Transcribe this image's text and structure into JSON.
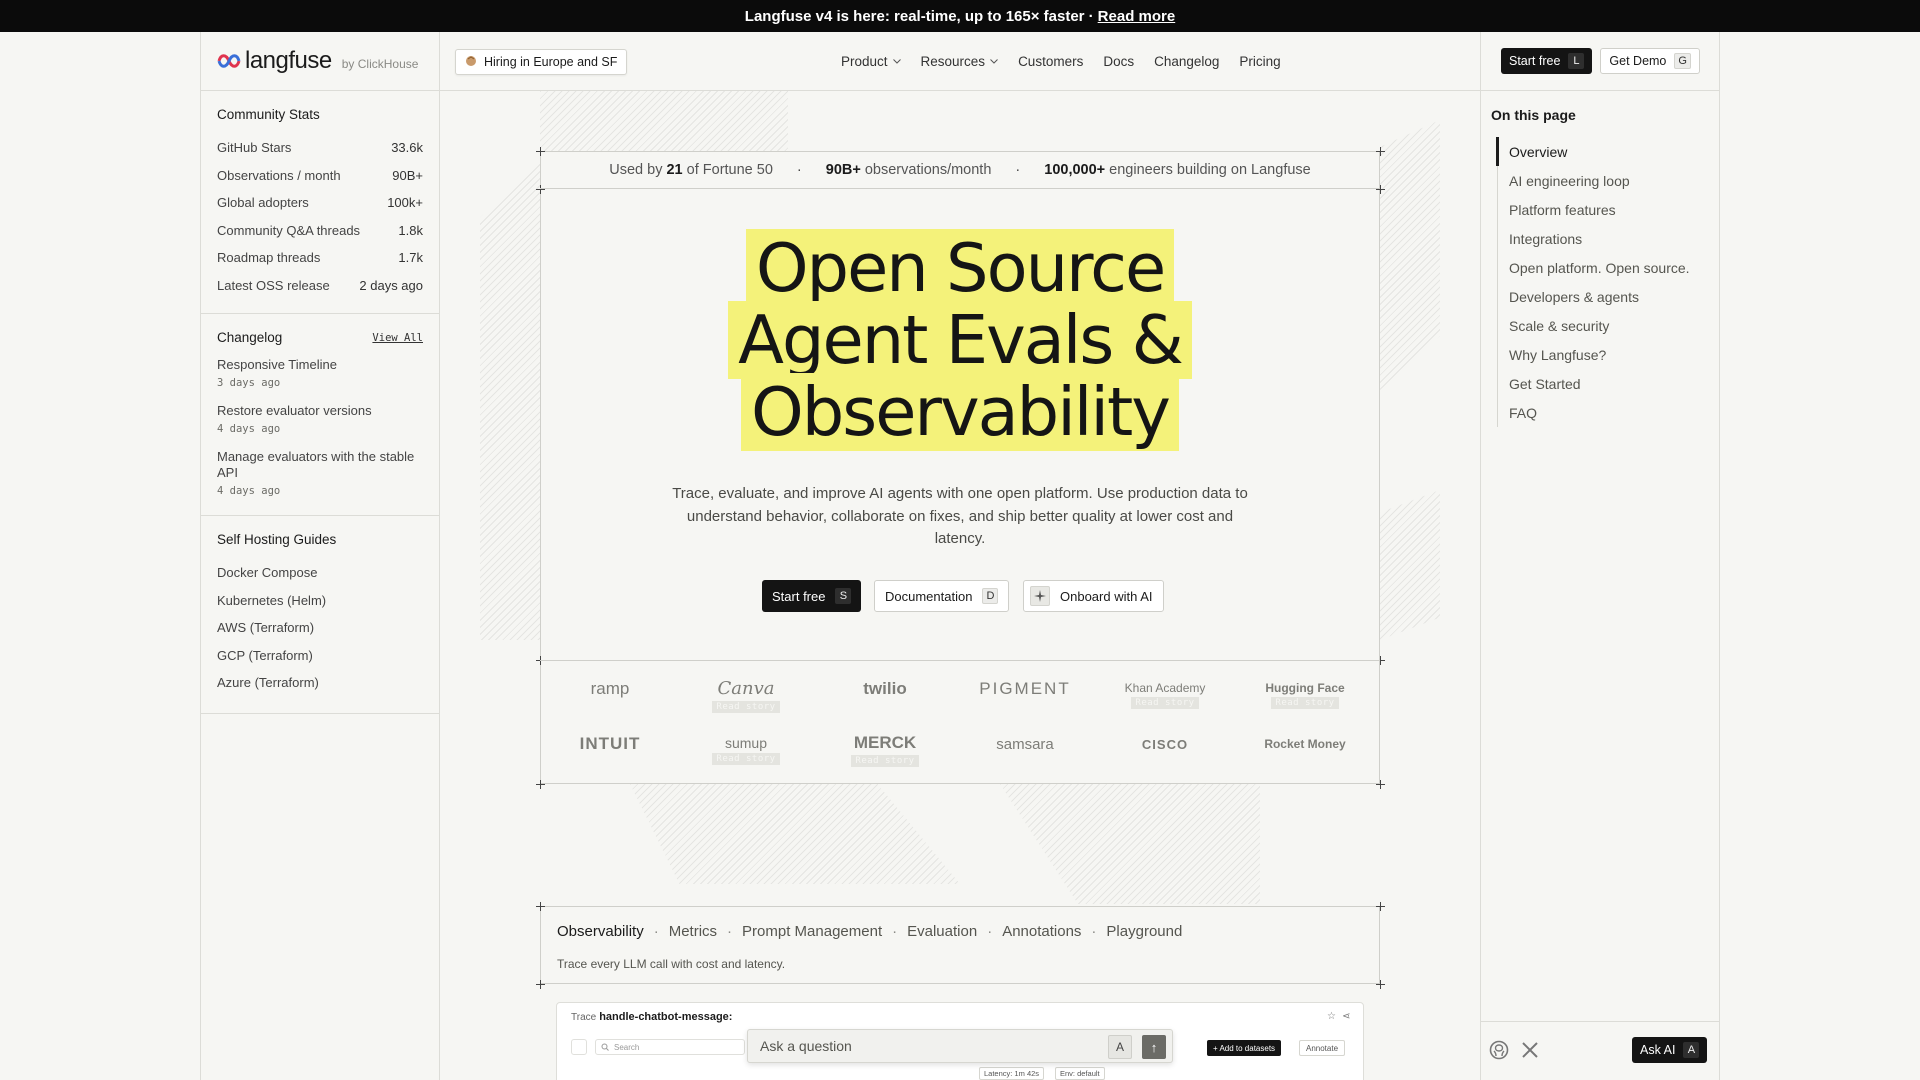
{
  "announcement": {
    "text": "Langfuse v4 is here: real-time, up to 165× faster ·",
    "link": "Read more"
  },
  "header": {
    "logo": "langfuse",
    "byline": "by ClickHouse",
    "hiring": "Hiring in Europe and SF",
    "nav": [
      "Product",
      "Resources",
      "Customers",
      "Docs",
      "Changelog",
      "Pricing"
    ],
    "start_free": {
      "label": "Start free",
      "key": "L"
    },
    "get_demo": {
      "label": "Get Demo",
      "key": "G"
    }
  },
  "community_stats": {
    "title": "Community Stats",
    "rows": [
      {
        "label": "GitHub Stars",
        "value": "33.6k"
      },
      {
        "label": "Observations / month",
        "value": "90B+"
      },
      {
        "label": "Global adopters",
        "value": "100k+"
      },
      {
        "label": "Community Q&A threads",
        "value": "1.8k"
      },
      {
        "label": "Roadmap threads",
        "value": "1.7k"
      },
      {
        "label": "Latest OSS release",
        "value": "2 days ago"
      }
    ]
  },
  "changelog": {
    "title": "Changelog",
    "view_all": "View All",
    "items": [
      {
        "title": "Responsive Timeline",
        "date": "3 days ago"
      },
      {
        "title": "Restore evaluator versions",
        "date": "4 days ago"
      },
      {
        "title": "Manage evaluators with the stable API",
        "date": "4 days ago"
      }
    ]
  },
  "self_hosting": {
    "title": "Self Hosting Guides",
    "items": [
      "Docker Compose",
      "Kubernetes (Helm)",
      "AWS (Terraform)",
      "GCP (Terraform)",
      "Azure (Terraform)"
    ]
  },
  "toc": {
    "title": "On this page",
    "items": [
      "Overview",
      "AI engineering loop",
      "Platform features",
      "Integrations",
      "Open platform. Open source.",
      "Developers & agents",
      "Scale & security",
      "Why Langfuse?",
      "Get Started",
      "FAQ"
    ],
    "active": "Overview"
  },
  "stats_bar": {
    "s1_pre": "Used by",
    "s1_num": "21",
    "s1_post": "of Fortune 50",
    "s2_num": "90B+",
    "s2_post": "observations/month",
    "s3_num": "100,000+",
    "s3_post": "engineers building on Langfuse"
  },
  "hero": {
    "title_lines": [
      "Open Source",
      "Agent Evals &",
      "Observability"
    ],
    "subtitle": "Trace, evaluate, and improve AI agents with one open platform. Use production data to understand behavior, collaborate on fixes, and ship better quality at lower cost and latency.",
    "cta_start": {
      "label": "Start free",
      "key": "S"
    },
    "cta_docs": {
      "label": "Documentation",
      "key": "D"
    },
    "cta_onboard": {
      "label": "Onboard with AI"
    },
    "highlight_color": "#f4f27a"
  },
  "customer_logos": {
    "read_story": "Read story",
    "row1": [
      "ramp",
      "Canva",
      "twilio",
      "PIGMENT",
      "Khan Academy",
      "Hugging Face"
    ],
    "row2": [
      "INTUIT",
      "sumup",
      "MERCK",
      "samsara",
      "CISCO",
      "Rocket Money"
    ]
  },
  "features": {
    "tabs": [
      "Observability",
      "Metrics",
      "Prompt Management",
      "Evaluation",
      "Annotations",
      "Playground"
    ],
    "active": "Observability",
    "description": "Trace every LLM call with cost and latency."
  },
  "preview": {
    "trace_label": "Trace",
    "trace_name": "handle-chatbot-message:",
    "search_placeholder": "Search",
    "add_to_datasets": "+ Add to datasets",
    "annotate": "Annotate",
    "latency": "Latency: 1m 42s",
    "env": "Env: default"
  },
  "ask_box": {
    "placeholder": "Ask a question",
    "key": "A"
  },
  "ask_ai": {
    "label": "Ask AI",
    "key": "A"
  }
}
